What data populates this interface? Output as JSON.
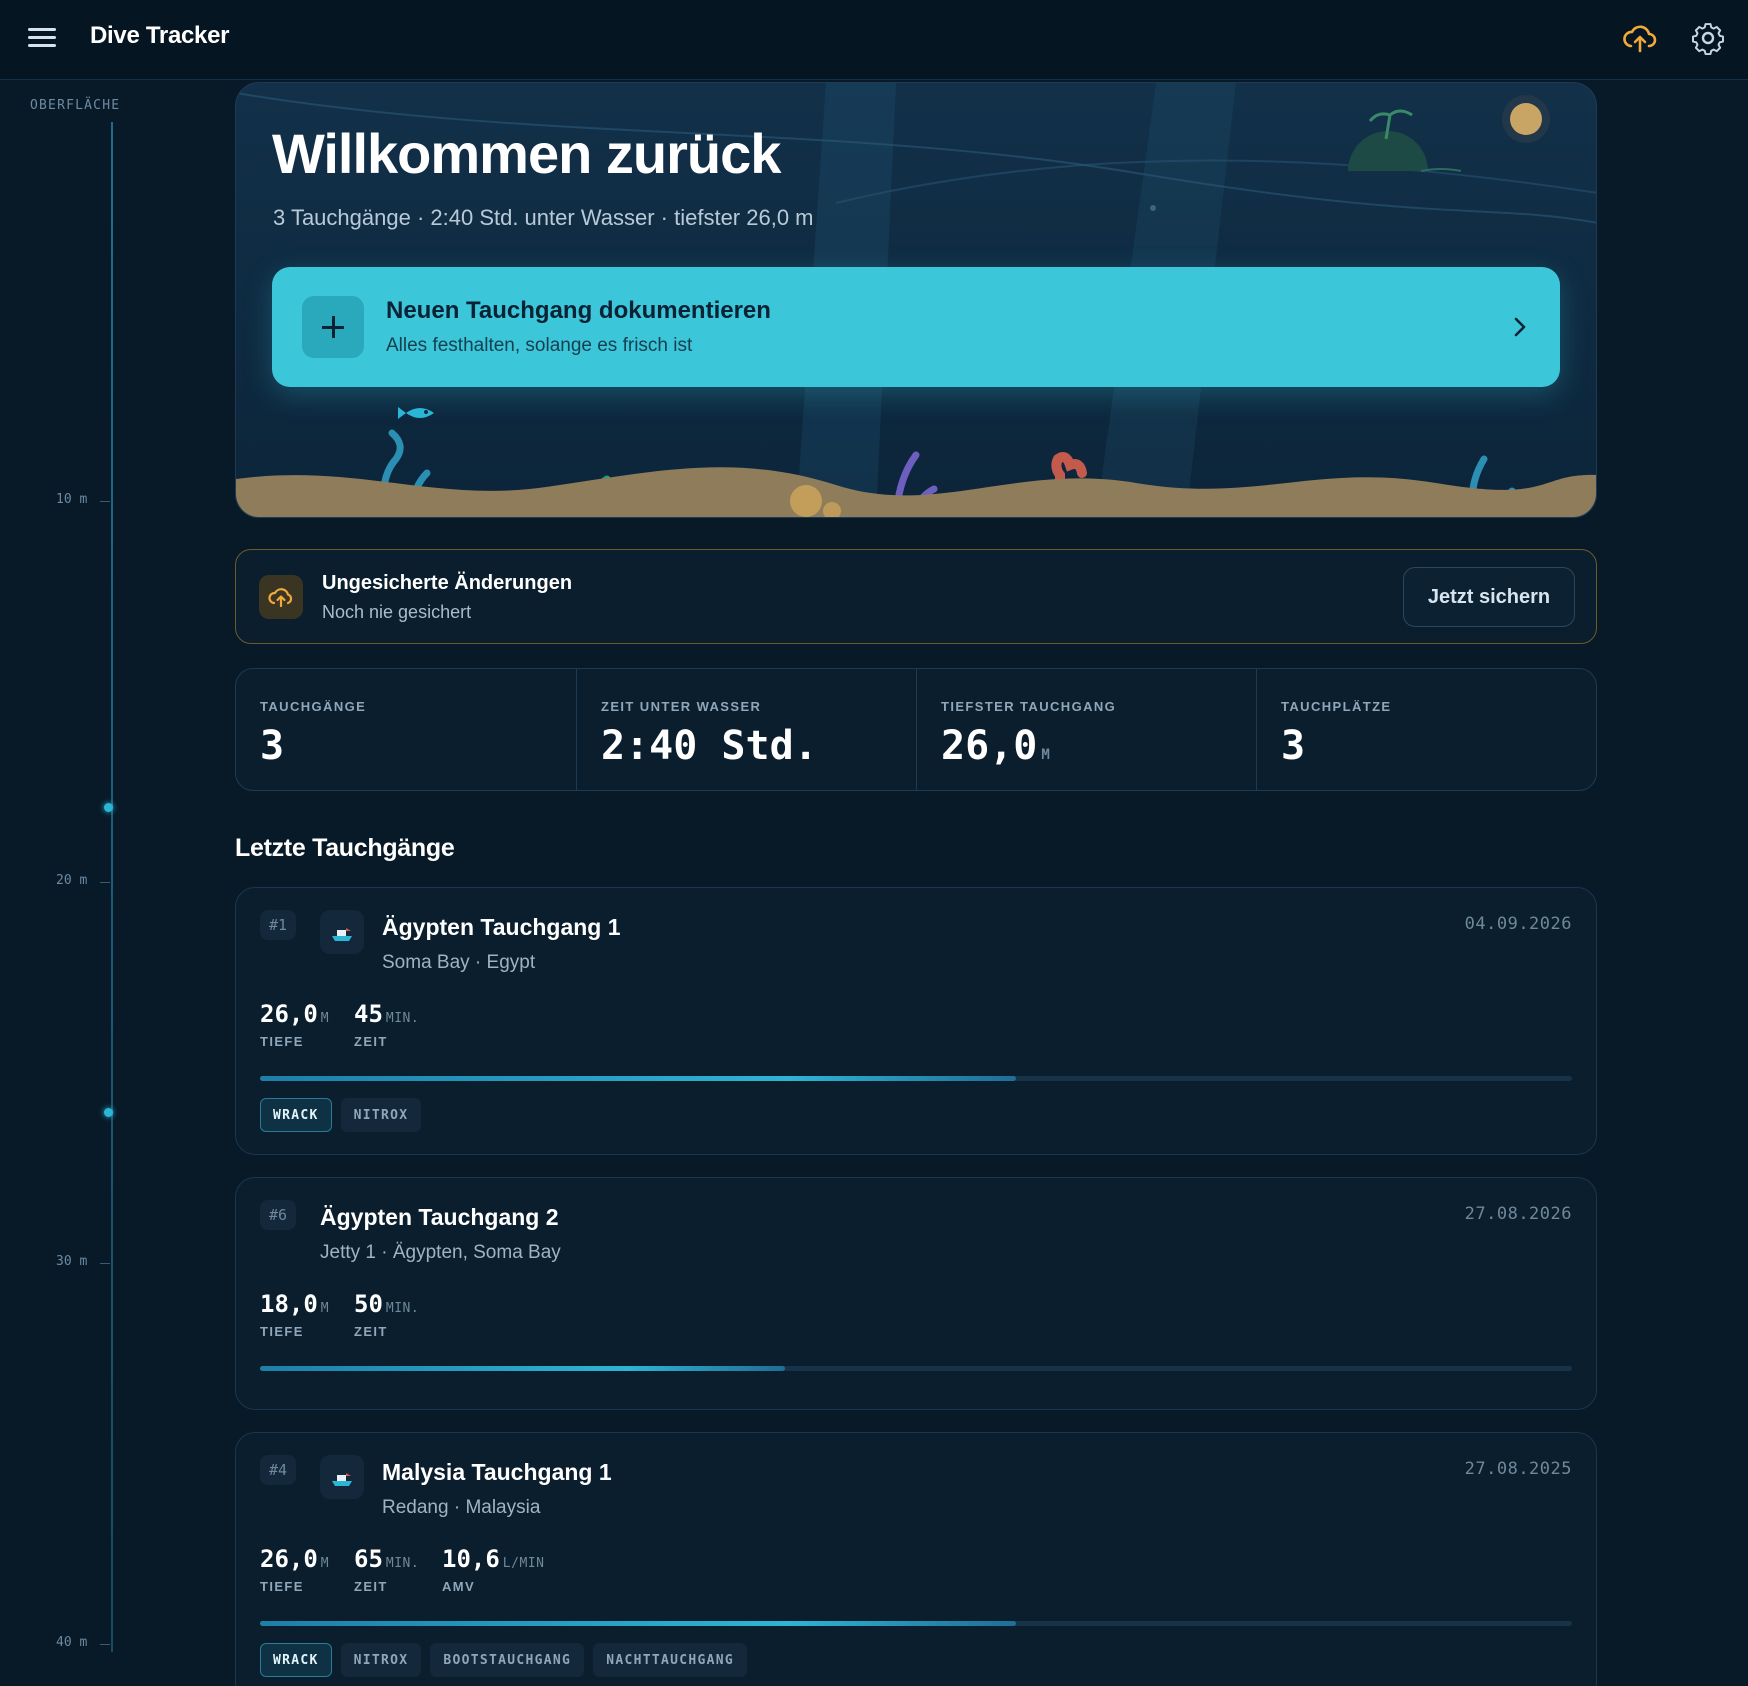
{
  "app": {
    "title": "Dive Tracker"
  },
  "depth_rail": {
    "top_label": "OBERFLÄCHE",
    "ticks": [
      "10 m",
      "20 m",
      "30 m",
      "40 m"
    ]
  },
  "hero": {
    "title": "Willkommen zurück",
    "subtitle": "3 Tauchgänge · 2:40 Std. unter Wasser · tiefster 26,0 m",
    "cta_title": "Neuen Tauchgang dokumentieren",
    "cta_subtitle": "Alles festhalten, solange es frisch ist"
  },
  "unsaved": {
    "title": "Ungesicherte Änderungen",
    "subtitle": "Noch nie gesichert",
    "button": "Jetzt sichern"
  },
  "stats": [
    {
      "label": "TAUCHGÄNGE",
      "value": "3",
      "unit": ""
    },
    {
      "label": "ZEIT UNTER WASSER",
      "value": "2:40 Std.",
      "unit": ""
    },
    {
      "label": "TIEFSTER TAUCHGANG",
      "value": "26,0",
      "unit": "M"
    },
    {
      "label": "TAUCHPLÄTZE",
      "value": "3",
      "unit": ""
    }
  ],
  "recent": {
    "title": "Letzte Tauchgänge",
    "dives": [
      {
        "number": "#1",
        "title": "Ägypten Tauchgang 1",
        "location": "Soma Bay · Egypt",
        "date": "04.09.2026",
        "depth": "26,0",
        "depth_unit": "M",
        "depth_label": "TIEFE",
        "time": "45",
        "time_unit": "MIN.",
        "time_label": "ZEIT",
        "depth_fraction": 0.576,
        "tags": [
          "WRACK",
          "NITROX"
        ]
      },
      {
        "number": "#6",
        "title": "Ägypten Tauchgang 2",
        "location": "Jetty 1 · Ägypten, Soma Bay",
        "date": "27.08.2026",
        "depth": "18,0",
        "depth_unit": "M",
        "depth_label": "TIEFE",
        "time": "50",
        "time_unit": "MIN.",
        "time_label": "ZEIT",
        "depth_fraction": 0.4,
        "tags": []
      },
      {
        "number": "#4",
        "title": "Malysia Tauchgang 1",
        "location": "Redang · Malaysia",
        "date": "27.08.2025",
        "depth": "26,0",
        "depth_unit": "M",
        "depth_label": "TIEFE",
        "time": "65",
        "time_unit": "MIN.",
        "time_label": "ZEIT",
        "amv": "10,6",
        "amv_unit": "L/MIN",
        "amv_label": "AMV",
        "depth_fraction": 0.576,
        "tags": [
          "WRACK",
          "NITROX",
          "BOOTSTAUCHGANG",
          "NACHTTAUCHGANG"
        ]
      }
    ]
  },
  "colors": {
    "accent": "#3bc6da",
    "warning": "#f0a93a",
    "background": "#081a28"
  },
  "icons": [
    "menu-icon",
    "cloud-upload-icon",
    "gear-icon",
    "plus-icon",
    "chevron-right-icon",
    "boat-icon"
  ]
}
